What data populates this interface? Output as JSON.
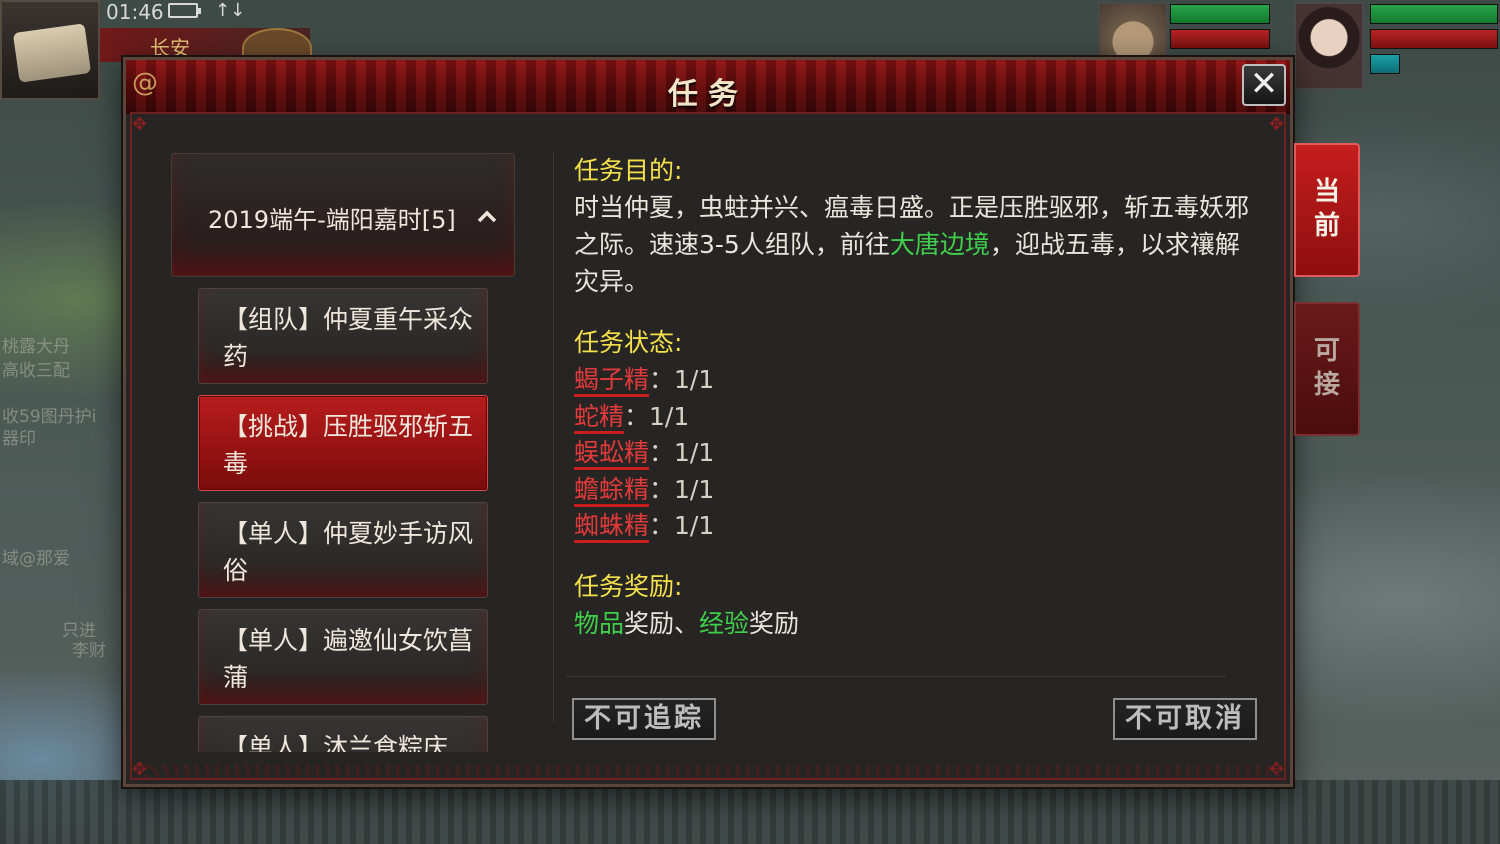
{
  "hud": {
    "time": "01:46",
    "signal": "↑↓",
    "location": "长安"
  },
  "background_text": [
    "桃露大丹",
    "高收三配",
    "收59图丹护i",
    "器印",
    "域@那爱",
    "只进",
    "李财"
  ],
  "dialog": {
    "title": "任务",
    "close_label": "✕"
  },
  "quest_list": {
    "category": "2019端午-端阳嘉时[5]",
    "items": [
      {
        "label": "【组队】仲夏重午采众药",
        "selected": false
      },
      {
        "label": "【挑战】压胜驱邪斩五毒",
        "selected": true
      },
      {
        "label": "【单人】仲夏妙手访风俗",
        "selected": false
      },
      {
        "label": "【单人】遍邀仙女饮菖蒲",
        "selected": false
      },
      {
        "label": "【单人】沐兰食粽庆",
        "selected": false
      }
    ]
  },
  "details": {
    "goal_title": "任务目的:",
    "goal_text_1": "时当仲夏，虫蛀并兴、瘟毒日盛。正是压胜驱邪，斩五毒妖邪之际。速速3-5人组队，前往",
    "goal_location": "大唐边境",
    "goal_text_2": "，迎战五毒，以求禳解灾异。",
    "status_title": "任务状态:",
    "status": [
      {
        "name": "蝎子精",
        "count": "：1/1"
      },
      {
        "name": "蛇精",
        "count": "：1/1"
      },
      {
        "name": "蜈蚣精",
        "count": "：1/1"
      },
      {
        "name": "蟾蜍精",
        "count": "：1/1"
      },
      {
        "name": "蜘蛛精",
        "count": "：1/1"
      }
    ],
    "reward_title": "任务奖励:",
    "reward_item_hl": "物品",
    "reward_item": "奖励、",
    "reward_exp_hl": "经验",
    "reward_exp": "奖励"
  },
  "buttons": {
    "track": "不可追踪",
    "cancel": "不可取消"
  },
  "side_tabs": {
    "current": "当前",
    "available": "可接"
  },
  "colors": {
    "accent_red": "#c81e1e",
    "title_yellow": "#f4e04a",
    "highlight_green": "#3fcf4a"
  }
}
